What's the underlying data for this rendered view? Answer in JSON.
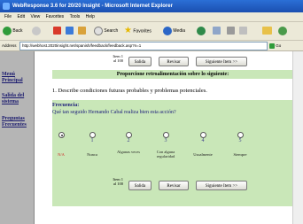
{
  "window": {
    "title": "WebResponse 3.6 for 20/20 Insight - Microsoft Internet Explorer"
  },
  "menu": [
    "File",
    "Edit",
    "View",
    "Favorites",
    "Tools",
    "Help"
  ],
  "toolbar": {
    "back": "Back",
    "search": "Search",
    "favorites": "Favorites",
    "media": "Media"
  },
  "address": {
    "label": "Address",
    "url": "http://webhost.2020insight.net/spanish/feedback/feedback.asp?n=1",
    "go": "Go"
  },
  "sidebar": {
    "menu_line1": "Menú",
    "menu_line2": "Principal",
    "exit_line1": "Salida del",
    "exit_line2": "sistema",
    "faq_line1": "Preguntas",
    "faq_line2": "Frecuentes"
  },
  "nav": {
    "item_label": "Item 1",
    "item_count": "al 100",
    "exit": "Salida",
    "review": "Revisar",
    "next": "Siguiente Item >>"
  },
  "banner": "Proporcione retroalimentación sobre lo siguiente:",
  "question": "1.  Describe condiciones futuras probables y problemas potenciales.",
  "frequency": {
    "label": "Frecuencia:",
    "prompt": "Qué tan seguido Hernando Cabal realiza bien esta acción?"
  },
  "scale": {
    "numbers": [
      "1",
      "2",
      "3",
      "4",
      "5"
    ],
    "labels": [
      "N/A",
      "Nunca",
      "Algunas veces",
      "Con alguna regularidad",
      "Usualmente",
      "Siempre"
    ],
    "selected": "N/A"
  }
}
